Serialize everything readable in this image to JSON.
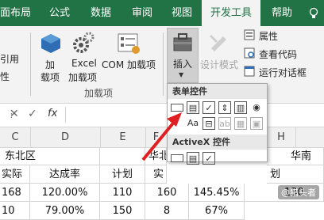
{
  "tabs": [
    "面布局",
    "公式",
    "数据",
    "审阅",
    "视图",
    "开发工具",
    "帮助"
  ],
  "ribbon": {
    "left_cut_label_1": "引用",
    "left_cut_label_2": "性",
    "addins": {
      "btn1_l1": "加",
      "btn1_l2": "载项",
      "btn2_l1": "Excel",
      "btn2_l2": "加载项",
      "btn3": "COM 加载项",
      "group_label": "加载项"
    },
    "controls": {
      "insert_label": "插入",
      "design_mode_label": "设计模式",
      "properties_label": "属性",
      "view_code_label": "查看代码",
      "run_dialog_label": "运行对话框"
    }
  },
  "formula_bar": {
    "cancel": "✕",
    "confirm": "✓",
    "fx": "fx"
  },
  "columns": [
    "C",
    "D",
    "E",
    "F",
    "G",
    "H"
  ],
  "sheet": {
    "row1": {
      "c": "东北区",
      "f": "华北",
      "h": "华南"
    },
    "row2": {
      "c": "实际",
      "d": "达成率",
      "e": "计划",
      "f": "实",
      "g": "",
      "h": "划"
    },
    "row3": {
      "c": "168",
      "d": "120.00%",
      "e": "110",
      "f": "160",
      "g": "145.45%",
      "h": "130"
    },
    "row4": {
      "c": "10",
      "d": "79.00%",
      "e": "150",
      "f": "8",
      "g": "67%",
      "h": "13"
    }
  },
  "popup": {
    "form_title": "表单控件",
    "activex_title": "ActiveX 控件"
  },
  "watermark": "@猎头者"
}
